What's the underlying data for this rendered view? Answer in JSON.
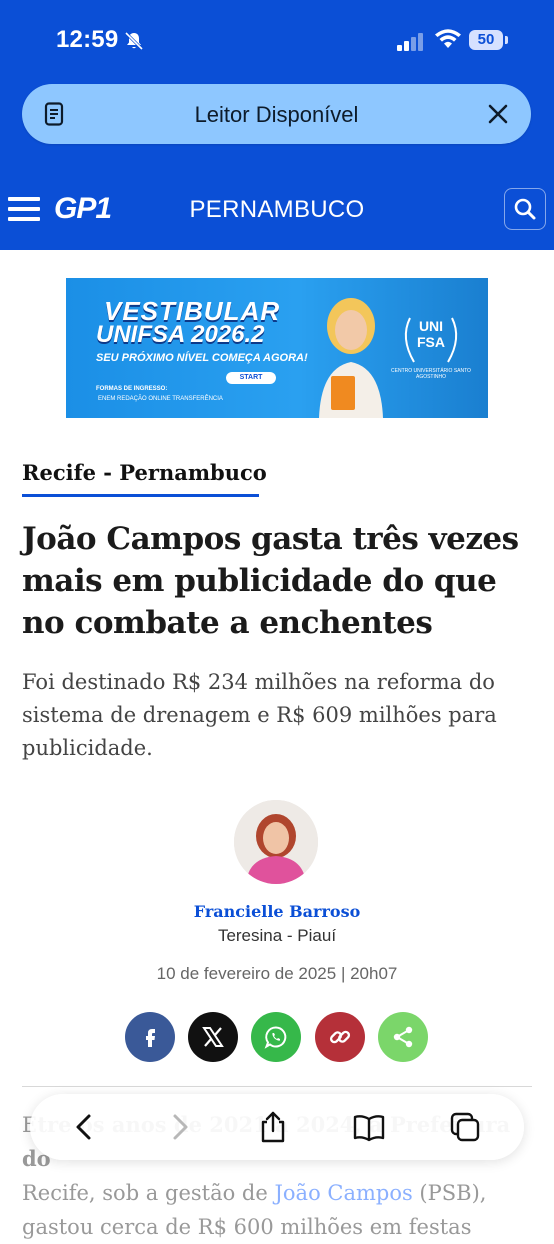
{
  "status_bar": {
    "time": "12:59",
    "battery": "50"
  },
  "reader": {
    "label": "Leitor Disponível"
  },
  "site_nav": {
    "logo": "GP1",
    "section": "PERNAMBUCO"
  },
  "ad": {
    "headline_line1": "VESTIBULAR",
    "headline_line2": "UNIFSA 2026.2",
    "tagline": "SEU PRÓXIMO NÍVEL COMEÇA AGORA!",
    "start_label": "START",
    "forms_title": "FORMAS DE INGRESSO:",
    "forms_options": "ENEM   REDAÇÃO ONLINE   TRANSFERÊNCIA",
    "seal_line1": "UNI",
    "seal_line2": "FSA",
    "seal_sub": "CENTRO UNIVERSITÁRIO SANTO AGOSTINHO"
  },
  "article": {
    "category": "Recife - Pernambuco",
    "headline": "João Campos gasta três vezes mais em publicidade do que no combate a enchentes",
    "subhead": "Foi destinado R$ 234 milhões na reforma do sistema de drenagem e R$ 609 milhões para publicidade.",
    "author_name": "Francielle Barroso",
    "author_location": "Teresina - Piauí",
    "date": "10 de fevereiro de 2025 | 20h07",
    "body_line1_start": "E",
    "body_line1_bold": "tre os anos de 2021 a 2024, a Prefeitura do",
    "body_line2_start": "Recife, sob a gestão de ",
    "body_line2_link": "João Campos",
    "body_line2_end": " (PSB),",
    "body_line3": "gastou cerca de R$ 600 milhões em festas"
  },
  "share_icons": [
    "facebook-icon",
    "x-icon",
    "whatsapp-icon",
    "link-icon",
    "share-icon"
  ],
  "toolbar_icons": [
    "back-icon",
    "forward-icon",
    "share-icon",
    "bookmarks-icon",
    "tabs-icon"
  ],
  "colors": {
    "brand_blue": "#0b4fd6",
    "reader_pill": "#8ec7ff",
    "author_link": "#0b4fd6"
  }
}
